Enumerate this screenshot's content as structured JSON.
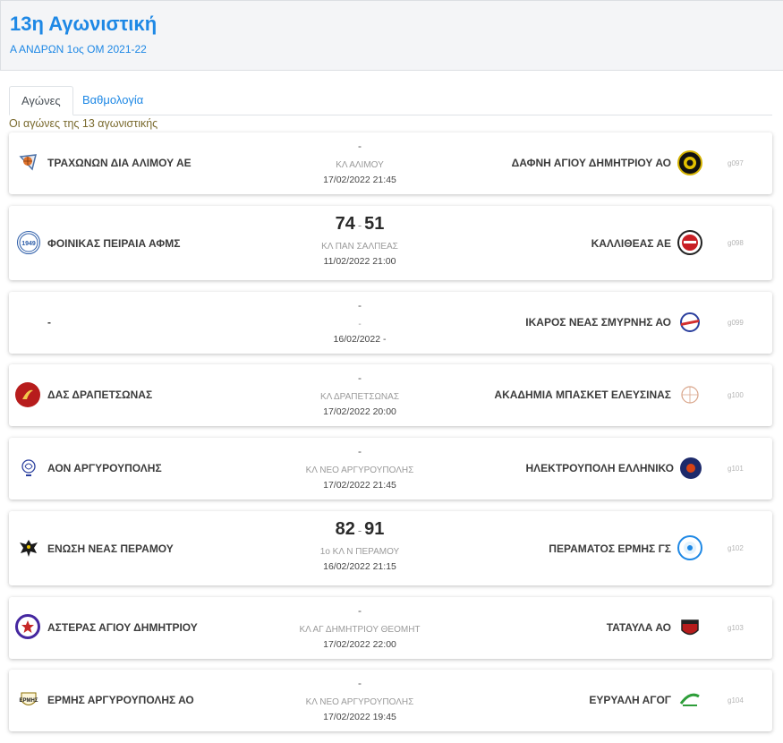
{
  "header": {
    "title": "13η Αγωνιστική",
    "subtitle": "Α ΑΝΔΡΩΝ 1ος ΟΜ 2021-22"
  },
  "tabs": [
    {
      "label": "Αγώνες",
      "active": true
    },
    {
      "label": "Βαθμολογία",
      "active": false
    }
  ],
  "note": "Οι αγώνες της 13 αγωνιστικής",
  "matches": [
    {
      "home": "ΤΡΑΧΩΝΩΝ ΔΙΑ ΑΛΙΜΟΥ ΑΕ",
      "home_logo": "basketball-logo-icon",
      "away": "ΔΑΦΝΗ ΑΓΙΟΥ ΔΗΜΗΤΡΙΟΥ ΑΟ",
      "away_logo": "daphne-crest-icon",
      "score_home": "",
      "score_away": "",
      "dash": "-",
      "venue": "ΚΛ ΑΛΙΜΟΥ",
      "datetime": "17/02/2022 21:45",
      "code": "g097"
    },
    {
      "home": "ΦΟΙΝΙΚΑΣ ΠΕΙΡΑΙΑ ΑΦΜΣ",
      "home_logo": "phoenix-1949-logo-icon",
      "away": "ΚΑΛΛΙΘΕΑΣ ΑΕ",
      "away_logo": "kallithea-logo-icon",
      "score_home": "74",
      "score_away": "51",
      "dash": "-",
      "venue": "ΚΛ ΠΑΝ ΣΑΛΠΕΑΣ",
      "datetime": "11/02/2022 21:00",
      "code": "g098"
    },
    {
      "home": "-",
      "home_logo": "",
      "away": "ΙΚΑΡΟΣ ΝΕΑΣ ΣΜΥΡΝΗΣ ΑΟ",
      "away_logo": "ikaros-logo-icon",
      "score_home": "",
      "score_away": "",
      "dash": "-",
      "venue": "-",
      "datetime": "16/02/2022 -",
      "code": "g099"
    },
    {
      "home": "ΔΑΣ ΔΡΑΠΕΤΣΩΝΑΣ",
      "home_logo": "das-logo-icon",
      "away": "ΑΚΑΔΗΜΙΑ ΜΠΑΣΚΕΤ ΕΛΕΥΣΙΝΑΣ",
      "away_logo": "academy-logo-icon",
      "score_home": "",
      "score_away": "",
      "dash": "-",
      "venue": "ΚΛ ΔΡΑΠΕΤΣΩΝΑΣ",
      "datetime": "17/02/2022 20:00",
      "code": "g100"
    },
    {
      "home": "ΑΟΝ ΑΡΓΥΡΟΥΠΟΛΗΣ",
      "home_logo": "aon-logo-icon",
      "away": "ΗΛΕΚΤΡΟΥΠΟΛΗ ΕΛΛΗΝΙΚΟ",
      "away_logo": "ilektroupoli-logo-icon",
      "score_home": "",
      "score_away": "",
      "dash": "-",
      "venue": "ΚΛ ΝΕΟ ΑΡΓΥΡΟΥΠΟΛΗΣ",
      "datetime": "17/02/2022 21:45",
      "code": "g101"
    },
    {
      "home": "ΕΝΩΣΗ ΝΕΑΣ ΠΕΡΑΜΟΥ",
      "home_logo": "eagle-logo-icon",
      "away": "ΠΕΡΑΜΑΤΟΣ ΕΡΜΗΣ ΓΣ",
      "away_logo": "ermis-perama-logo-icon",
      "score_home": "82",
      "score_away": "91",
      "dash": "-",
      "venue": "1ο ΚΛ Ν ΠΕΡΑΜΟΥ",
      "datetime": "16/02/2022 21:15",
      "code": "g102"
    },
    {
      "home": "ΑΣΤΕΡΑΣ ΑΓΙΟΥ ΔΗΜΗΤΡΙΟΥ",
      "home_logo": "star-logo-icon",
      "away": "ΤΑΤΑΥΛΑ ΑΟ",
      "away_logo": "tatavla-logo-icon",
      "score_home": "",
      "score_away": "",
      "dash": "-",
      "venue": "ΚΛ ΑΓ ΔΗΜΗΤΡΙΟΥ ΘΕΟΜΗΤ",
      "datetime": "17/02/2022 22:00",
      "code": "g103"
    },
    {
      "home": "ΕΡΜΗΣ ΑΡΓΥΡΟΥΠΟΛΗΣ ΑΟ",
      "home_logo": "ermis-logo-icon",
      "away": "ΕΥΡΥΑΛΗ ΑΓΟΓ",
      "away_logo": "evryali-logo-icon",
      "score_home": "",
      "score_away": "",
      "dash": "-",
      "venue": "ΚΛ ΝΕΟ ΑΡΓΥΡΟΥΠΟΛΗΣ",
      "datetime": "17/02/2022 19:45",
      "code": "g104"
    }
  ]
}
